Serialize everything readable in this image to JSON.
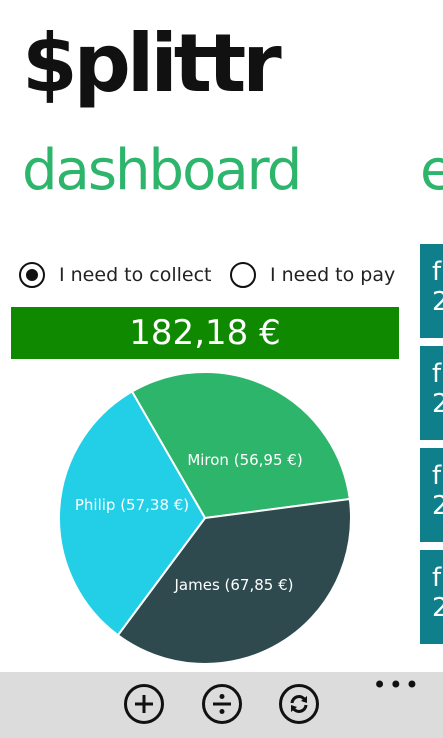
{
  "app": {
    "title": "$plittr"
  },
  "pivot": {
    "current": "dashboard",
    "next_partial": "e"
  },
  "mode": {
    "options": [
      {
        "label": "I need to collect",
        "selected": true
      },
      {
        "label": "I need to pay",
        "selected": false
      }
    ]
  },
  "total": {
    "amount": "182,18 €",
    "color": "#0f8a00"
  },
  "chart_data": {
    "type": "pie",
    "slices": [
      {
        "label": "Miron  (56,95 €)",
        "name": "Miron",
        "value": 56.95,
        "color": "#2db56c"
      },
      {
        "label": "James  (67,85 €)",
        "name": "James",
        "value": 67.85,
        "color": "#2e4a4f"
      },
      {
        "label": "Philip  (57,38 €)",
        "name": "Philip",
        "value": 57.38,
        "color": "#22cfe6"
      }
    ]
  },
  "side_tiles": [
    {
      "line1": "f",
      "line2": "2"
    },
    {
      "line1": "f",
      "line2": "2"
    },
    {
      "line1": "f",
      "line2": "2"
    },
    {
      "line1": "f",
      "line2": "2"
    }
  ],
  "app_bar": {
    "buttons": [
      {
        "icon": "add-icon"
      },
      {
        "icon": "divide-icon"
      },
      {
        "icon": "sync-icon"
      }
    ],
    "more": "•••"
  }
}
